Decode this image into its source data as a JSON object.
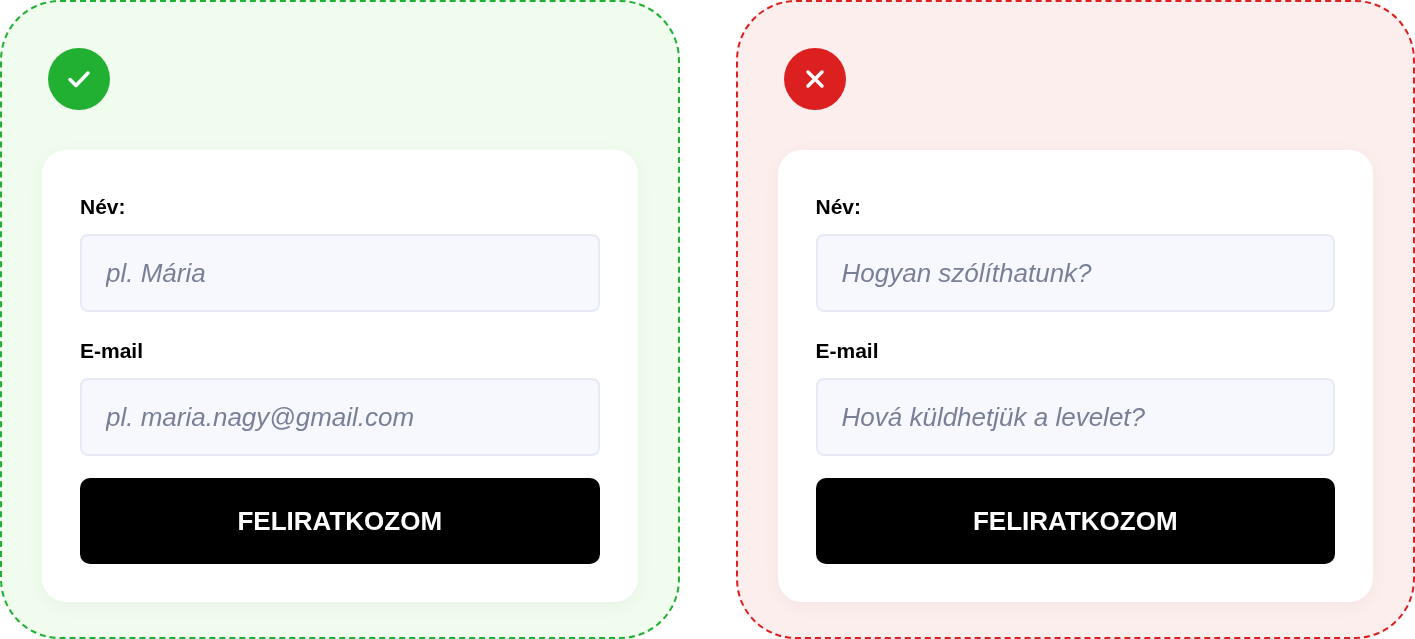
{
  "panels": [
    {
      "kind": "good",
      "fields": [
        {
          "label": "Név:",
          "placeholder": "pl. Mária"
        },
        {
          "label": "E-mail",
          "placeholder": "pl. maria.nagy@gmail.com"
        }
      ],
      "button": "FELIRATKOZOM"
    },
    {
      "kind": "bad",
      "fields": [
        {
          "label": "Név:",
          "placeholder": "Hogyan szólíthatunk?"
        },
        {
          "label": "E-mail",
          "placeholder": "Hová küldhetjük a levelet?"
        }
      ],
      "button": "FELIRATKOZOM"
    }
  ]
}
